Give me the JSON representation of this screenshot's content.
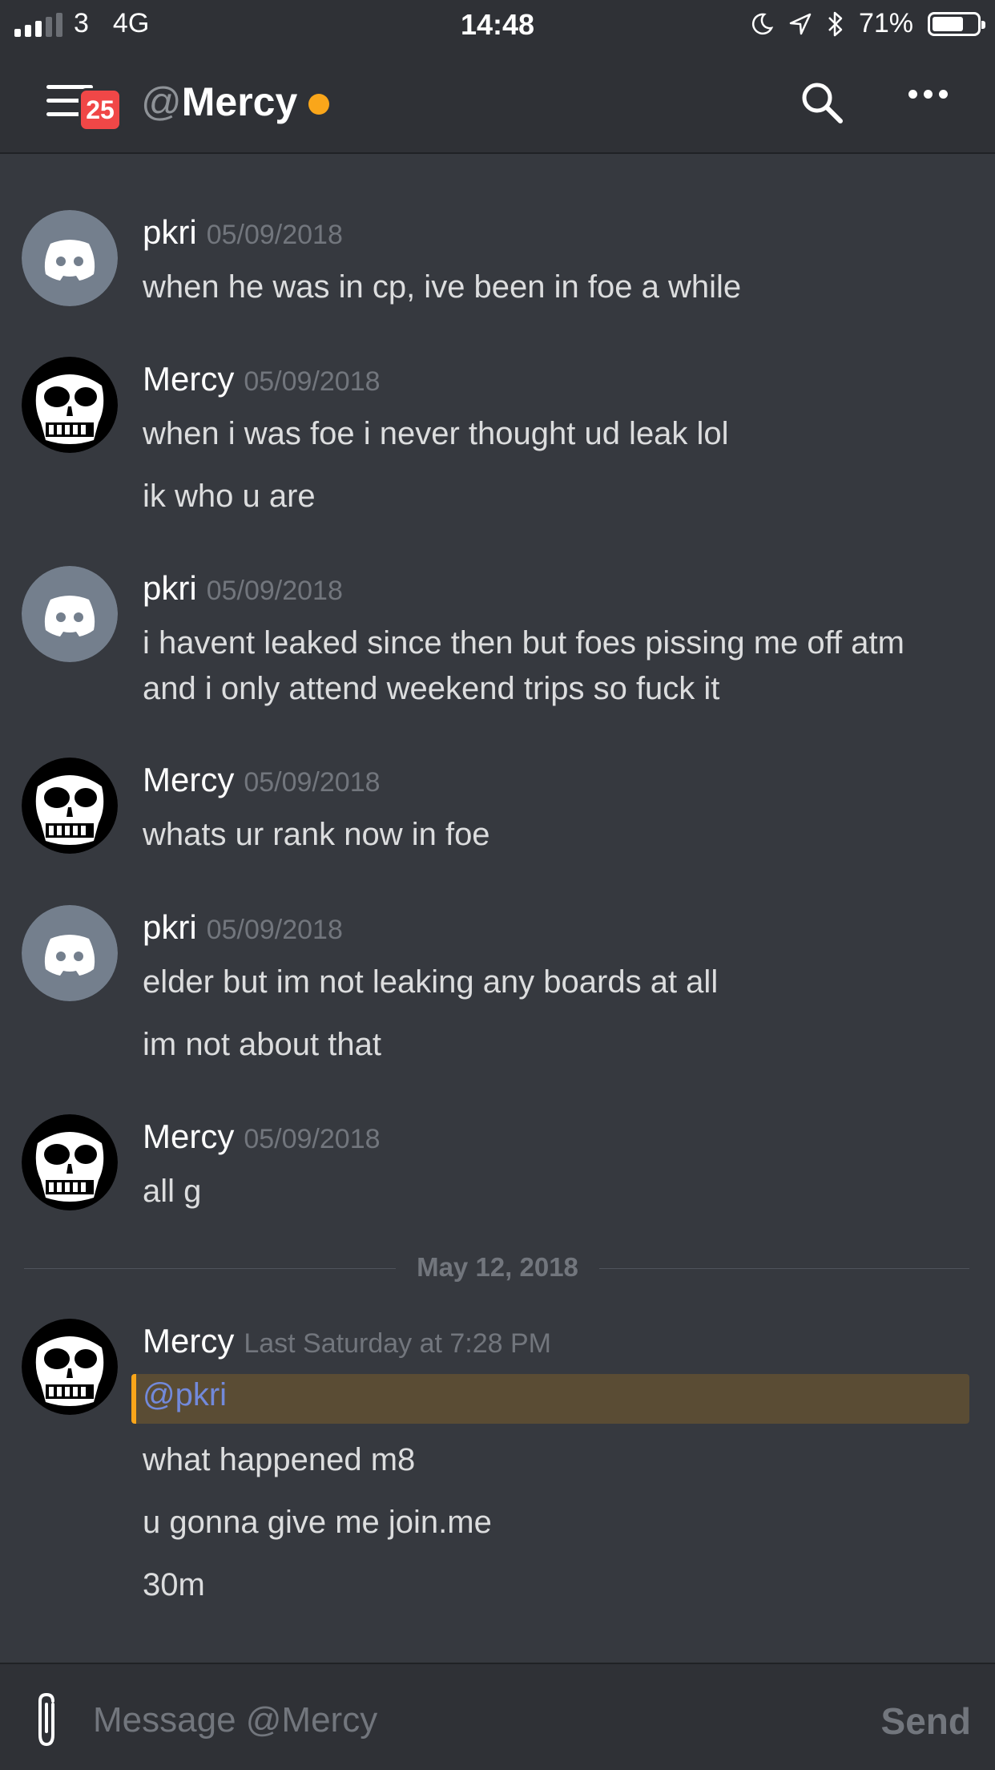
{
  "status_bar": {
    "carrier": "3",
    "network": "4G",
    "time": "14:48",
    "battery": "71%",
    "battery_level": 0.71,
    "icons": [
      "signal-icon",
      "moon-icon",
      "location-arrow-icon",
      "bluetooth-icon",
      "battery-icon"
    ]
  },
  "header": {
    "at": "@",
    "title": "Mercy",
    "unread_badge": "25",
    "status_color": "#faa61a",
    "icons": [
      "hamburger-menu-icon",
      "search-icon",
      "more-dots-icon"
    ]
  },
  "messages": [
    {
      "author": "pkri",
      "timestamp": "05/09/2018",
      "avatar": "discord-logo",
      "lines": [
        "when he was in cp, ive been in foe a while"
      ]
    },
    {
      "author": "Mercy",
      "timestamp": "05/09/2018",
      "avatar": "skull",
      "lines": [
        "when i was foe i never thought ud leak lol",
        "ik who u are"
      ]
    },
    {
      "author": "pkri",
      "timestamp": "05/09/2018",
      "avatar": "discord-logo",
      "lines": [
        "i havent leaked since then but foes pissing me off atm",
        "and i only attend weekend trips so fuck it"
      ]
    },
    {
      "author": "Mercy",
      "timestamp": "05/09/2018",
      "avatar": "skull",
      "lines": [
        "whats ur rank now in foe"
      ]
    },
    {
      "author": "pkri",
      "timestamp": "05/09/2018",
      "avatar": "discord-logo",
      "lines": [
        "elder but im not leaking any boards at all",
        "im not about that"
      ]
    },
    {
      "author": "Mercy",
      "timestamp": "05/09/2018",
      "avatar": "skull",
      "lines": [
        "all g"
      ]
    },
    {
      "author": "Mercy",
      "timestamp": "Last Saturday at 7:28 PM",
      "avatar": "skull",
      "mention": "@pkri",
      "lines": [
        "what happened m8",
        "u gonna give me join.me",
        "30m"
      ]
    }
  ],
  "date_divider": "May 12, 2018",
  "composer": {
    "placeholder": "Message @Mercy",
    "send_label": "Send"
  },
  "colors": {
    "background": "#36393f",
    "header": "#2f3136",
    "badge": "#f04747",
    "mention_highlight": "#5a4c34",
    "mention_text": "#7289da",
    "discord_avatar": "#747f8d"
  }
}
